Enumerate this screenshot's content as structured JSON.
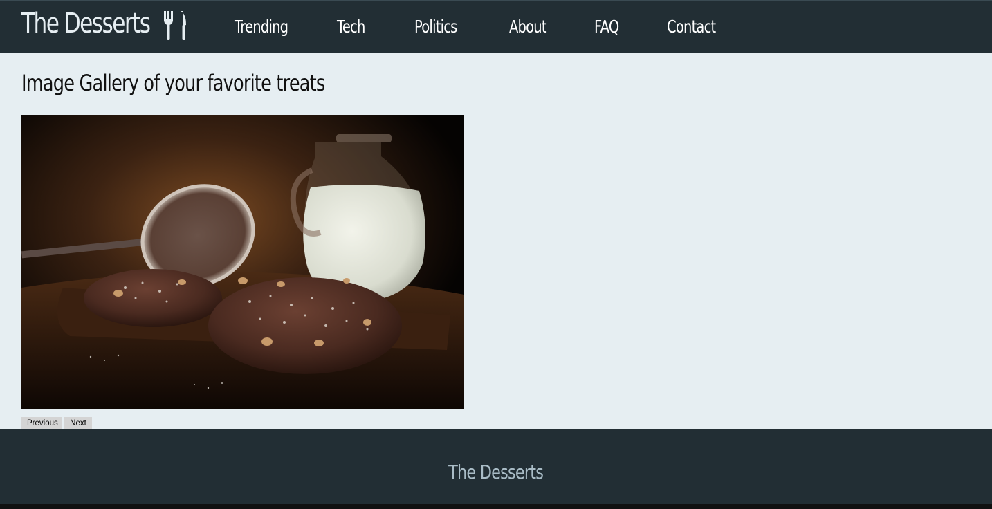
{
  "header": {
    "brand": "The Desserts",
    "brand_icon": "fork-knife-icon",
    "nav": [
      {
        "label": "Trending"
      },
      {
        "label": "Tech"
      },
      {
        "label": "Politics"
      },
      {
        "label": "About"
      },
      {
        "label": "FAQ"
      },
      {
        "label": "Contact"
      }
    ]
  },
  "main": {
    "title": "Image Gallery of your favorite treats",
    "gallery": {
      "image": "chocolate-cookies-and-milk-photo",
      "previous_label": "Previous",
      "next_label": "Next"
    }
  },
  "footer": {
    "brand": "The Desserts"
  },
  "colors": {
    "header_bg": "#222e34",
    "page_bg": "#e6eef2",
    "footer_text": "#a9bcc6",
    "button_bg": "#d4d4d4"
  }
}
